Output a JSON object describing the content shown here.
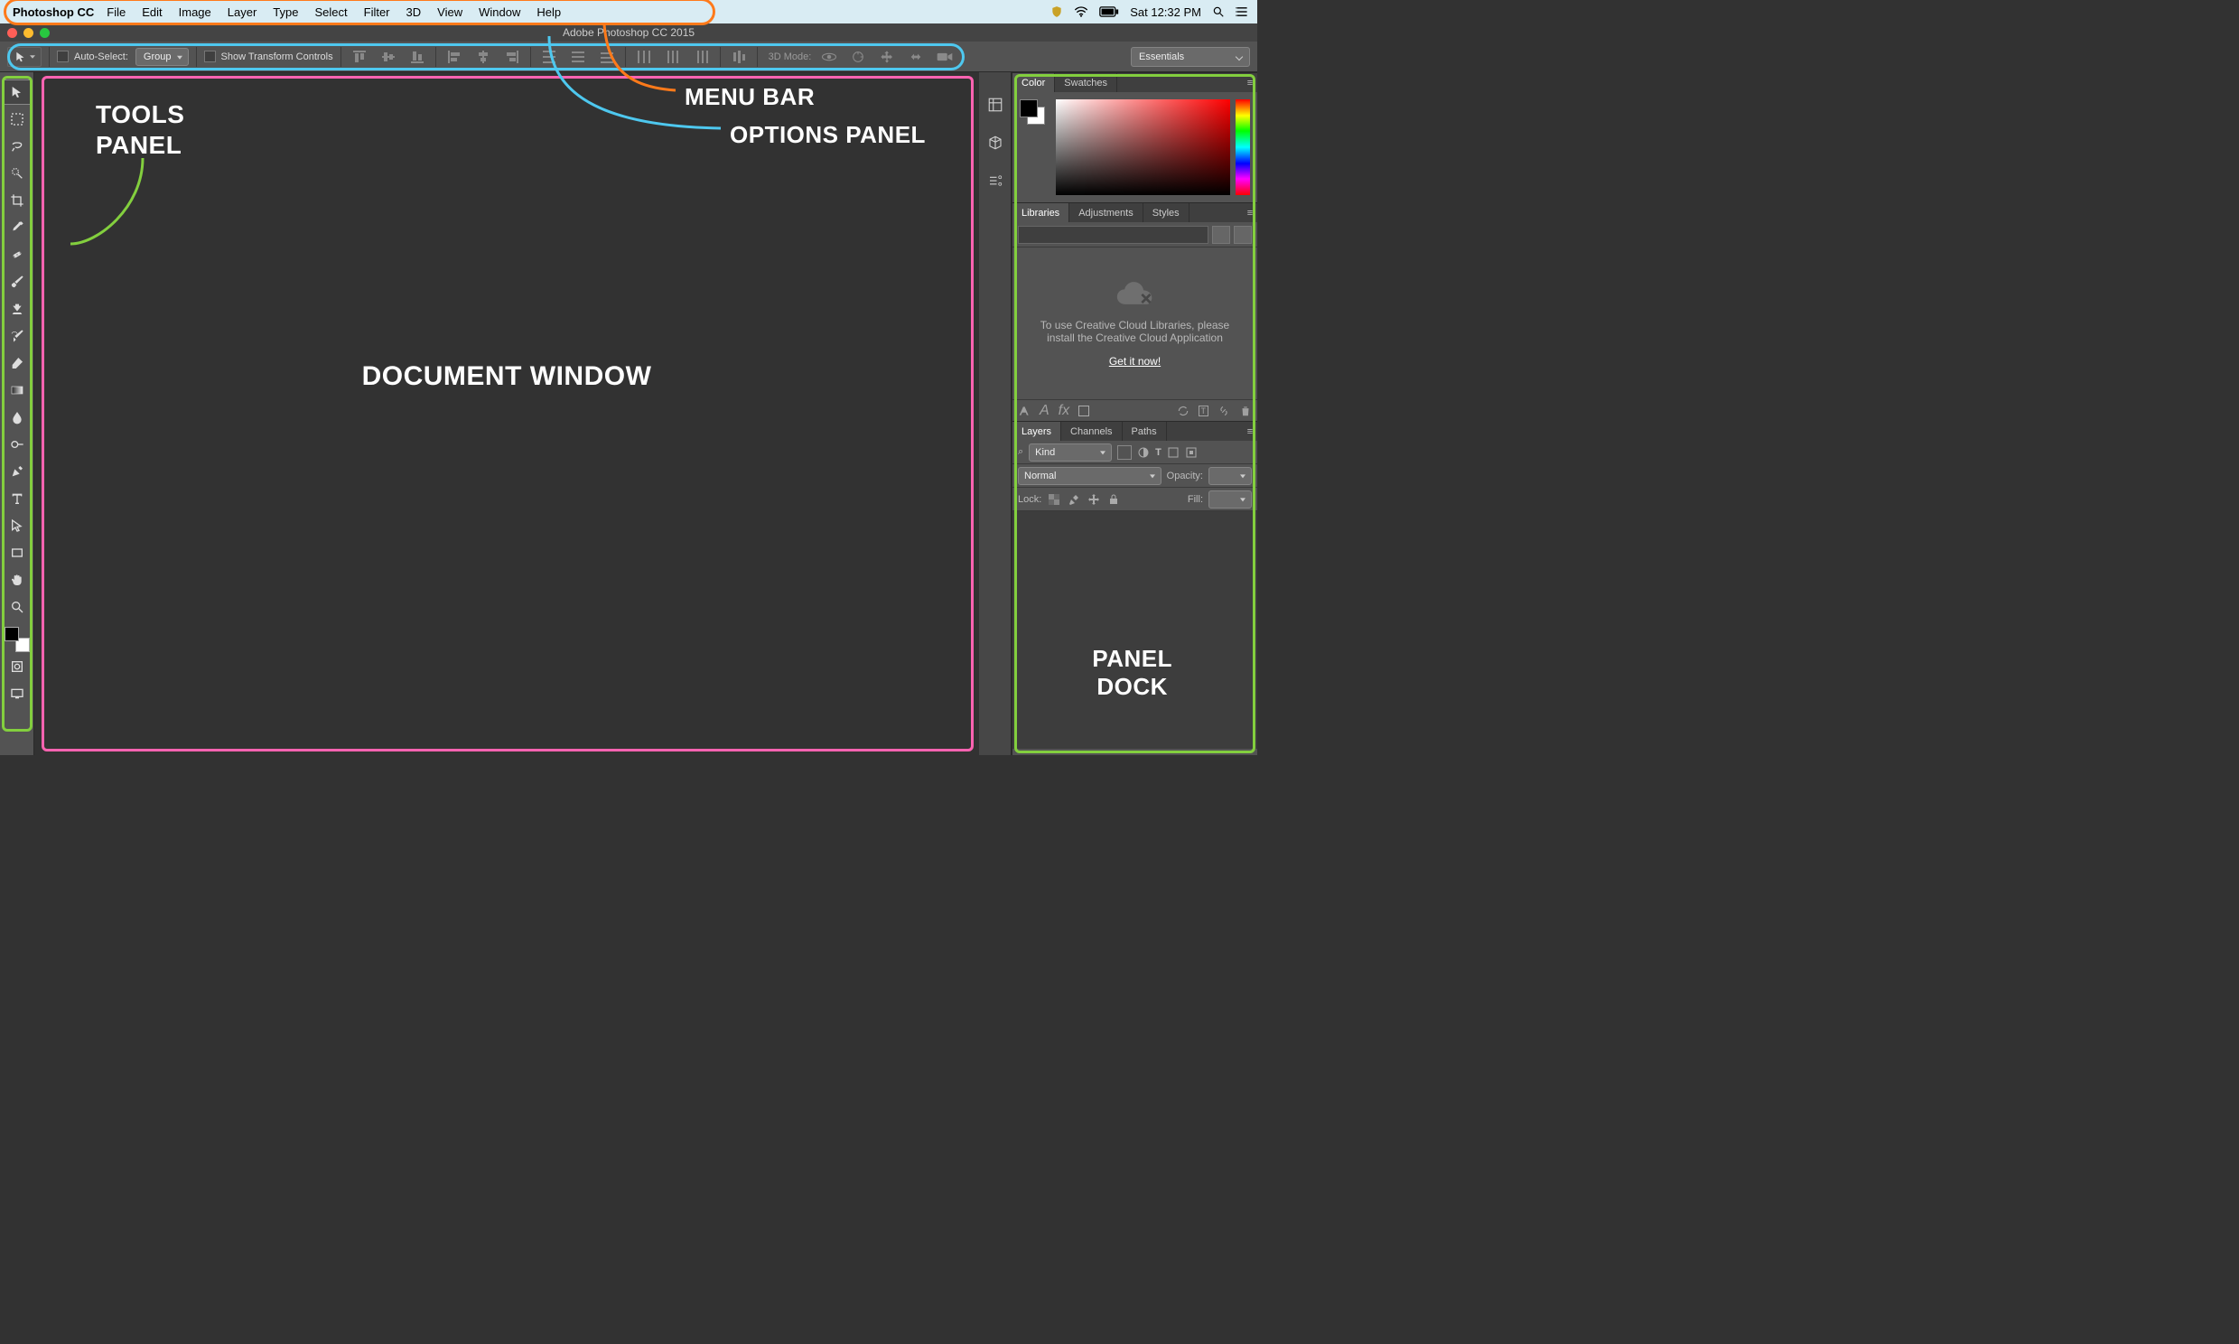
{
  "mac_menu": {
    "app_name": "Photoshop CC",
    "items": [
      "File",
      "Edit",
      "Image",
      "Layer",
      "Type",
      "Select",
      "Filter",
      "3D",
      "View",
      "Window",
      "Help"
    ],
    "clock": "Sat 12:32 PM"
  },
  "window": {
    "title": "Adobe Photoshop CC 2015"
  },
  "options_bar": {
    "auto_select_label": "Auto-Select:",
    "auto_select_mode": "Group",
    "show_transform_label": "Show Transform Controls",
    "mode_3d_label": "3D Mode:",
    "workspace": "Essentials"
  },
  "overlays": {
    "tools_panel_line1": "TOOLS",
    "tools_panel_line2": "PANEL",
    "document_window": "DOCUMENT WINDOW",
    "menu_bar": "MENU BAR",
    "options_panel": "OPTIONS PANEL",
    "panel_dock_line1": "PANEL",
    "panel_dock_line2": "DOCK"
  },
  "tools": [
    "move-tool",
    "marquee-tool",
    "lasso-tool",
    "quick-select-tool",
    "crop-tool",
    "eyedropper-tool",
    "spot-heal-tool",
    "brush-tool",
    "clone-stamp-tool",
    "history-brush-tool",
    "eraser-tool",
    "gradient-tool",
    "blur-tool",
    "dodge-tool",
    "pen-tool",
    "type-tool",
    "path-select-tool",
    "rectangle-tool",
    "hand-tool",
    "zoom-tool"
  ],
  "panels": {
    "color_tabs": [
      "Color",
      "Swatches"
    ],
    "lib_tabs": [
      "Libraries",
      "Adjustments",
      "Styles"
    ],
    "layers_tabs": [
      "Layers",
      "Channels",
      "Paths"
    ],
    "libraries": {
      "message": "To use Creative Cloud Libraries, please install the Creative Cloud Application",
      "cta": "Get it now!"
    },
    "layers": {
      "kind_label": "Kind",
      "blend_mode": "Normal",
      "opacity_label": "Opacity:",
      "lock_label": "Lock:",
      "fill_label": "Fill:"
    }
  }
}
